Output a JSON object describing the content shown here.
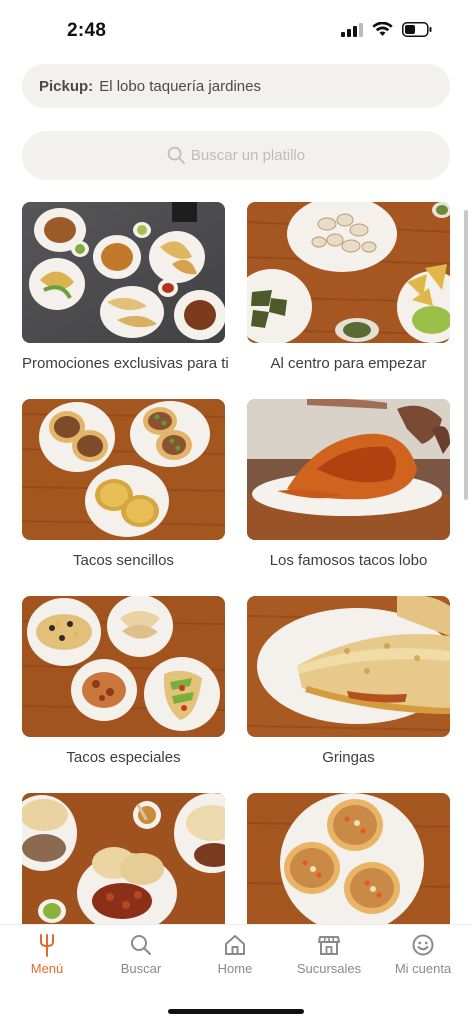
{
  "status": {
    "time": "2:48"
  },
  "pickup": {
    "label": "Pickup:",
    "location": "El lobo taquería jardines"
  },
  "search": {
    "placeholder": "Buscar un platillo"
  },
  "categories": [
    {
      "label": "Promociones exclusivas para ti",
      "icon": "mixed-platters-photo"
    },
    {
      "label": "Al centro para empezar",
      "icon": "appetizers-photo"
    },
    {
      "label": "Tacos sencillos",
      "icon": "simple-tacos-photo"
    },
    {
      "label": "Los famosos tacos lobo",
      "icon": "lobo-taco-photo"
    },
    {
      "label": "Tacos especiales",
      "icon": "special-tacos-photo"
    },
    {
      "label": "Gringas",
      "icon": "gringas-photo"
    },
    {
      "label": "",
      "icon": "tortillas-photo"
    },
    {
      "label": "",
      "icon": "tostadas-photo"
    }
  ],
  "tabbar": {
    "items": [
      {
        "label": "Menú",
        "icon": "fork-icon",
        "active": true
      },
      {
        "label": "Buscar",
        "icon": "search-icon",
        "active": false
      },
      {
        "label": "Home",
        "icon": "home-icon",
        "active": false
      },
      {
        "label": "Sucursales",
        "icon": "store-icon",
        "active": false
      },
      {
        "label": "Mi cuenta",
        "icon": "smiley-icon",
        "active": false
      }
    ]
  },
  "colors": {
    "accent": "#e1692f",
    "field_bg": "#f3f1ee",
    "wood": "#a2531f"
  }
}
